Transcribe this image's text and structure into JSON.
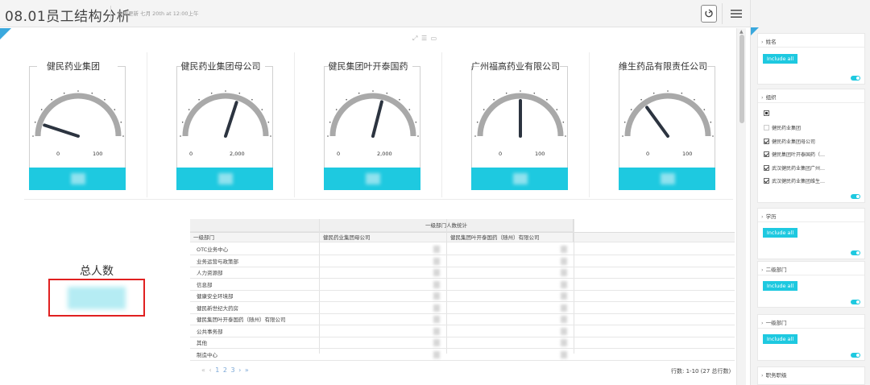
{
  "header": {
    "title": "08.01员工结构分析",
    "subtitle": "数据更新 七月 20th at 12:00上午"
  },
  "main": {
    "gauges": [
      {
        "name": "健民药业集团",
        "min": "0",
        "max": "100",
        "level": 0.1
      },
      {
        "name": "健民药业集团母公司",
        "min": "0",
        "max": "2,000",
        "level": 0.6
      },
      {
        "name": "健民集团叶开泰国药",
        "min": "0",
        "max": "2,000",
        "level": 0.58
      },
      {
        "name": "广州福高药业有限公司",
        "min": "0",
        "max": "100",
        "level": 0.5
      },
      {
        "name": "维生药品有限责任公司",
        "min": "0",
        "max": "100",
        "level": 0.3
      }
    ],
    "kpi": {
      "label": "总人数"
    },
    "pivot": {
      "group_header": "一级部门人数统计",
      "row_header": "一级部门",
      "col1": "健民药业集团母公司",
      "col2": "健民集团叶开泰国药（随州）有限公司",
      "rows": [
        "OTC业务中心",
        "业务运营与政策部",
        "人力资源部",
        "信息部",
        "健康安全环境部",
        "健民新世纪大药房",
        "健民集团叶开泰国药（随州）有限公司",
        "公共事务部",
        "其他",
        "制造中心"
      ],
      "pager": "1 2 3",
      "row_count": "行数: 1-10 (27 总行数)"
    }
  },
  "panel": {
    "cards": [
      {
        "title": "姓名",
        "include": "Include all"
      },
      {
        "title": "组织",
        "options": [
          {
            "label": "健民药业集团",
            "state": "empty"
          },
          {
            "label": "健民药业集团母公司",
            "state": "checked"
          },
          {
            "label": "健民集团叶开泰国药（…",
            "state": "checked"
          },
          {
            "label": "武汉健民药业集团广州…",
            "state": "checked"
          },
          {
            "label": "武汉健民药业集团维生…",
            "state": "checked"
          }
        ]
      },
      {
        "title": "学历",
        "include": "Include all"
      },
      {
        "title": "二级部门",
        "include": "Include all"
      },
      {
        "title": "一级部门",
        "include": "Include all"
      },
      {
        "title": "职务职级"
      }
    ]
  },
  "colors": {
    "accent": "#1ec9e0",
    "flag": "#3aa8dd",
    "highlight": "#e02020"
  }
}
